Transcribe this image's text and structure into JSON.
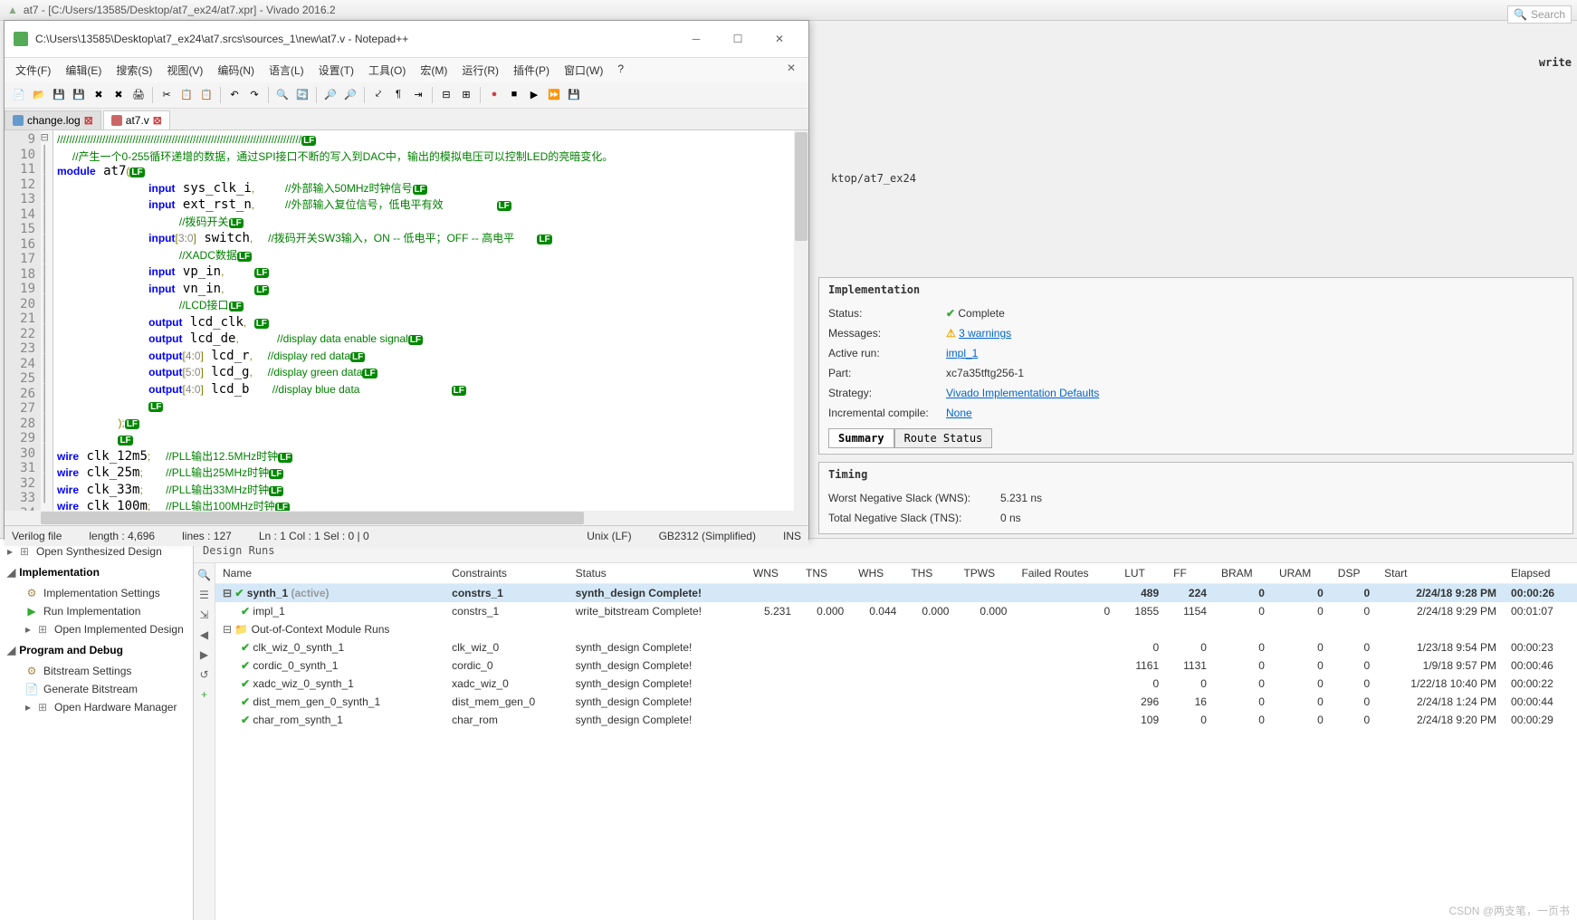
{
  "vivado": {
    "title": "at7 - [C:/Users/13585/Desktop/at7_ex24/at7.xpr] - Vivado 2016.2",
    "search_placeholder": "Search",
    "write_label": "write",
    "path_fragment": "ktop/at7_ex24"
  },
  "npp": {
    "title": "C:\\Users\\13585\\Desktop\\at7_ex24\\at7.srcs\\sources_1\\new\\at7.v - Notepad++",
    "menus": [
      "文件(F)",
      "编辑(E)",
      "搜索(S)",
      "视图(V)",
      "编码(N)",
      "语言(L)",
      "设置(T)",
      "工具(O)",
      "宏(M)",
      "运行(R)",
      "插件(P)",
      "窗口(W)",
      "?"
    ],
    "tabs": [
      {
        "name": "change.log",
        "active": false,
        "icon": "blue"
      },
      {
        "name": "at7.v",
        "active": true,
        "icon": "red"
      }
    ],
    "status": {
      "type": "Verilog file",
      "length": "length : 4,696",
      "lines": "lines : 127",
      "pos": "Ln : 1   Col : 1   Sel : 0 | 0",
      "eol": "Unix (LF)",
      "enc": "GB2312 (Simplified)",
      "mode": "INS"
    },
    "code_start_line": 9
  },
  "impl": {
    "title": "Implementation",
    "status_label": "Status:",
    "status_val": "Complete",
    "messages_label": "Messages:",
    "messages_val": "3 warnings",
    "active_run_label": "Active run:",
    "active_run_val": "impl_1",
    "part_label": "Part:",
    "part_val": "xc7a35tftg256-1",
    "strategy_label": "Strategy:",
    "strategy_val": "Vivado Implementation Defaults",
    "incremental_label": "Incremental compile:",
    "incremental_val": "None",
    "tab_summary": "Summary",
    "tab_route": "Route Status"
  },
  "timing": {
    "title": "Timing",
    "wns_label": "Worst Negative Slack (WNS):",
    "wns_val": "5.231 ns",
    "tns_label": "Total Negative Slack (TNS):",
    "tns_val": "0 ns"
  },
  "flow": {
    "open_synth": "Open Synthesized Design",
    "impl_header": "Implementation",
    "impl_settings": "Implementation Settings",
    "run_impl": "Run Implementation",
    "open_impl": "Open Implemented Design",
    "prog_header": "Program and Debug",
    "bitstream_settings": "Bitstream Settings",
    "gen_bitstream": "Generate Bitstream",
    "open_hw": "Open Hardware Manager"
  },
  "design_runs": {
    "title": "Design Runs",
    "headers": [
      "Name",
      "Constraints",
      "Status",
      "WNS",
      "TNS",
      "WHS",
      "THS",
      "TPWS",
      "Failed Routes",
      "LUT",
      "FF",
      "BRAM",
      "URAM",
      "DSP",
      "Start",
      "Elapsed"
    ],
    "rows": [
      {
        "indent": 0,
        "toggle": "⊟",
        "check": true,
        "name": "synth_1",
        "suffix": "(active)",
        "constraints": "constrs_1",
        "status": "synth_design Complete!",
        "wns": "",
        "tns": "",
        "whs": "",
        "ths": "",
        "tpws": "",
        "failed": "",
        "lut": "489",
        "ff": "224",
        "bram": "0",
        "uram": "0",
        "dsp": "0",
        "start": "2/24/18 9:28 PM",
        "elapsed": "00:00:26",
        "bold": true,
        "sel": true
      },
      {
        "indent": 1,
        "toggle": "",
        "check": true,
        "name": "impl_1",
        "suffix": "",
        "constraints": "constrs_1",
        "status": "write_bitstream Complete!",
        "wns": "5.231",
        "tns": "0.000",
        "whs": "0.044",
        "ths": "0.000",
        "tpws": "0.000",
        "failed": "0",
        "lut": "1855",
        "ff": "1154",
        "bram": "0",
        "uram": "0",
        "dsp": "0",
        "start": "2/24/18 9:29 PM",
        "elapsed": "00:01:07",
        "bold": false,
        "sel": false
      },
      {
        "indent": 0,
        "toggle": "⊟",
        "check": false,
        "folder": true,
        "name": "Out-of-Context Module Runs",
        "suffix": "",
        "constraints": "",
        "status": "",
        "wns": "",
        "tns": "",
        "whs": "",
        "ths": "",
        "tpws": "",
        "failed": "",
        "lut": "",
        "ff": "",
        "bram": "",
        "uram": "",
        "dsp": "",
        "start": "",
        "elapsed": "",
        "bold": false,
        "sel": false
      },
      {
        "indent": 1,
        "toggle": "",
        "check": true,
        "name": "clk_wiz_0_synth_1",
        "suffix": "",
        "constraints": "clk_wiz_0",
        "status": "synth_design Complete!",
        "wns": "",
        "tns": "",
        "whs": "",
        "ths": "",
        "tpws": "",
        "failed": "",
        "lut": "0",
        "ff": "0",
        "bram": "0",
        "uram": "0",
        "dsp": "0",
        "start": "1/23/18 9:54 PM",
        "elapsed": "00:00:23",
        "bold": false,
        "sel": false
      },
      {
        "indent": 1,
        "toggle": "",
        "check": true,
        "name": "cordic_0_synth_1",
        "suffix": "",
        "constraints": "cordic_0",
        "status": "synth_design Complete!",
        "wns": "",
        "tns": "",
        "whs": "",
        "ths": "",
        "tpws": "",
        "failed": "",
        "lut": "1161",
        "ff": "1131",
        "bram": "0",
        "uram": "0",
        "dsp": "0",
        "start": "1/9/18 9:57 PM",
        "elapsed": "00:00:46",
        "bold": false,
        "sel": false
      },
      {
        "indent": 1,
        "toggle": "",
        "check": true,
        "name": "xadc_wiz_0_synth_1",
        "suffix": "",
        "constraints": "xadc_wiz_0",
        "status": "synth_design Complete!",
        "wns": "",
        "tns": "",
        "whs": "",
        "ths": "",
        "tpws": "",
        "failed": "",
        "lut": "0",
        "ff": "0",
        "bram": "0",
        "uram": "0",
        "dsp": "0",
        "start": "1/22/18 10:40 PM",
        "elapsed": "00:00:22",
        "bold": false,
        "sel": false
      },
      {
        "indent": 1,
        "toggle": "",
        "check": true,
        "name": "dist_mem_gen_0_synth_1",
        "suffix": "",
        "constraints": "dist_mem_gen_0",
        "status": "synth_design Complete!",
        "wns": "",
        "tns": "",
        "whs": "",
        "ths": "",
        "tpws": "",
        "failed": "",
        "lut": "296",
        "ff": "16",
        "bram": "0",
        "uram": "0",
        "dsp": "0",
        "start": "2/24/18 1:24 PM",
        "elapsed": "00:00:44",
        "bold": false,
        "sel": false
      },
      {
        "indent": 1,
        "toggle": "",
        "check": true,
        "name": "char_rom_synth_1",
        "suffix": "",
        "constraints": "char_rom",
        "status": "synth_design Complete!",
        "wns": "",
        "tns": "",
        "whs": "",
        "ths": "",
        "tpws": "",
        "failed": "",
        "lut": "109",
        "ff": "0",
        "bram": "0",
        "uram": "0",
        "dsp": "0",
        "start": "2/24/18 9:20 PM",
        "elapsed": "00:00:29",
        "bold": false,
        "sel": false
      }
    ]
  },
  "watermark": "CSDN @两支笔，一页书"
}
